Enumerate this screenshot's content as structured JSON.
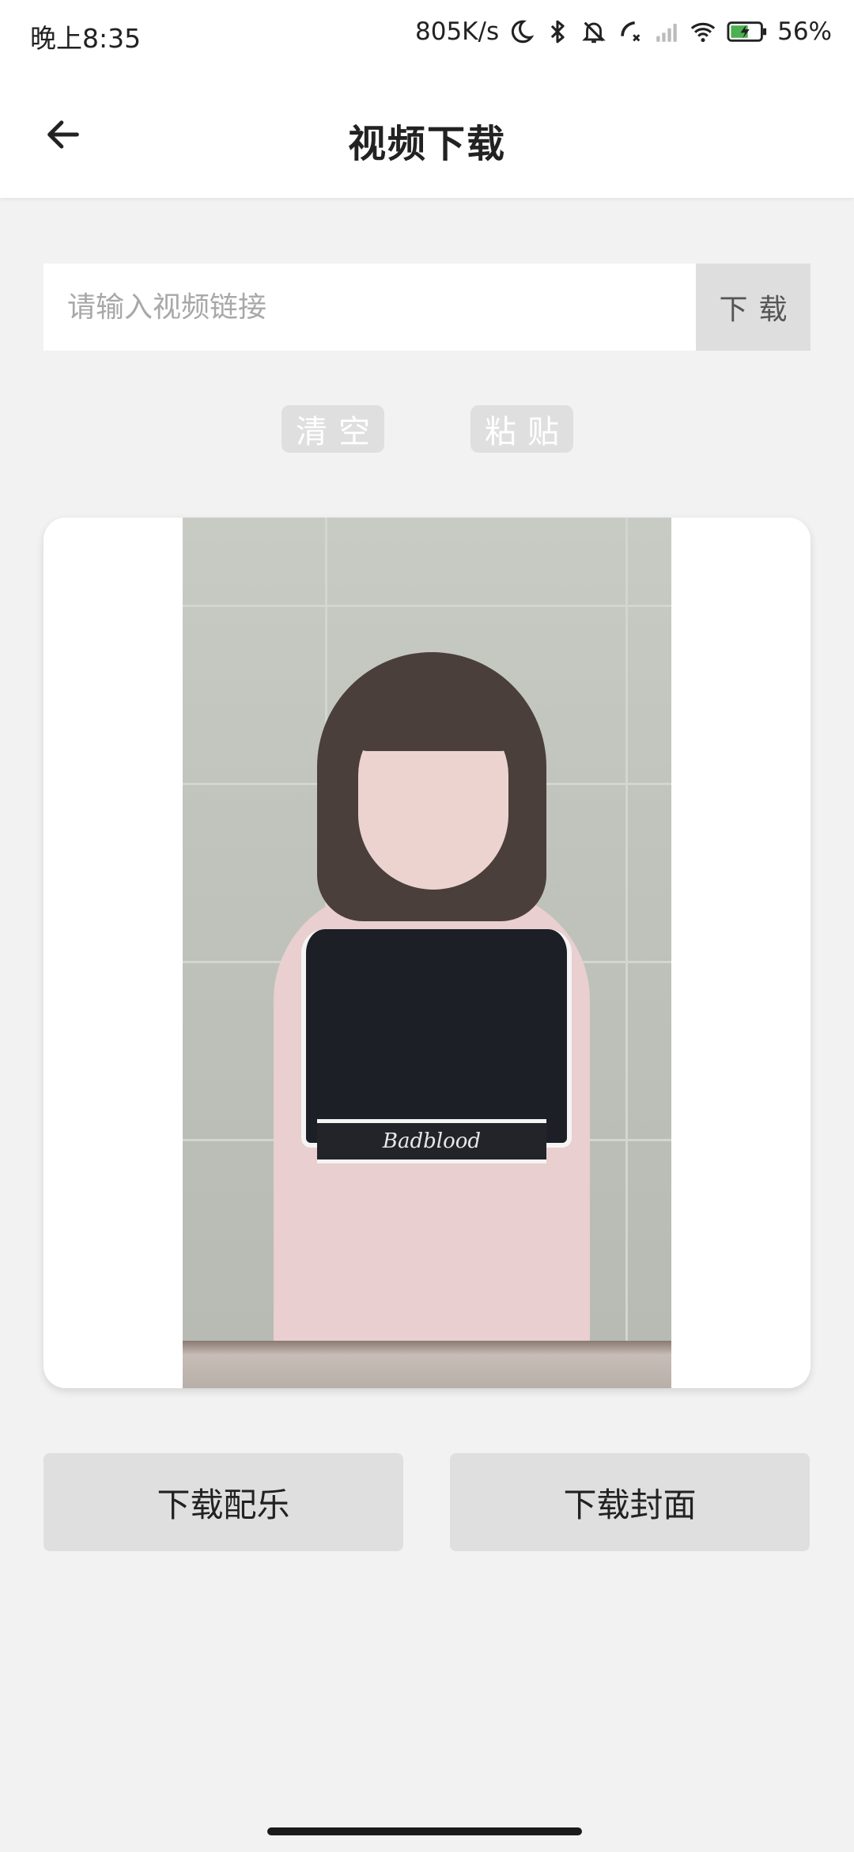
{
  "status_bar": {
    "time": "晚上8:35",
    "net_speed": "805K/s",
    "battery": "56%",
    "icons": [
      "moon-icon",
      "bluetooth-icon",
      "mute-bell-icon",
      "call-off-icon",
      "signal-icon",
      "wifi-icon",
      "battery-charging-icon"
    ]
  },
  "header": {
    "back_icon": "arrow-left-icon",
    "title": "视频下载"
  },
  "url_input": {
    "placeholder": "请输入视频链接",
    "value": ""
  },
  "download_button": {
    "label": "下载"
  },
  "clear_button": {
    "label": "清空"
  },
  "paste_button": {
    "label": "粘贴"
  },
  "preview": {
    "shirt_text": "Badblood"
  },
  "download_music_button": {
    "label": "下载配乐"
  },
  "download_cover_button": {
    "label": "下载封面"
  },
  "colors": {
    "background": "#f2f2f2",
    "button_gray": "#dfdfdf",
    "text": "#222222"
  }
}
